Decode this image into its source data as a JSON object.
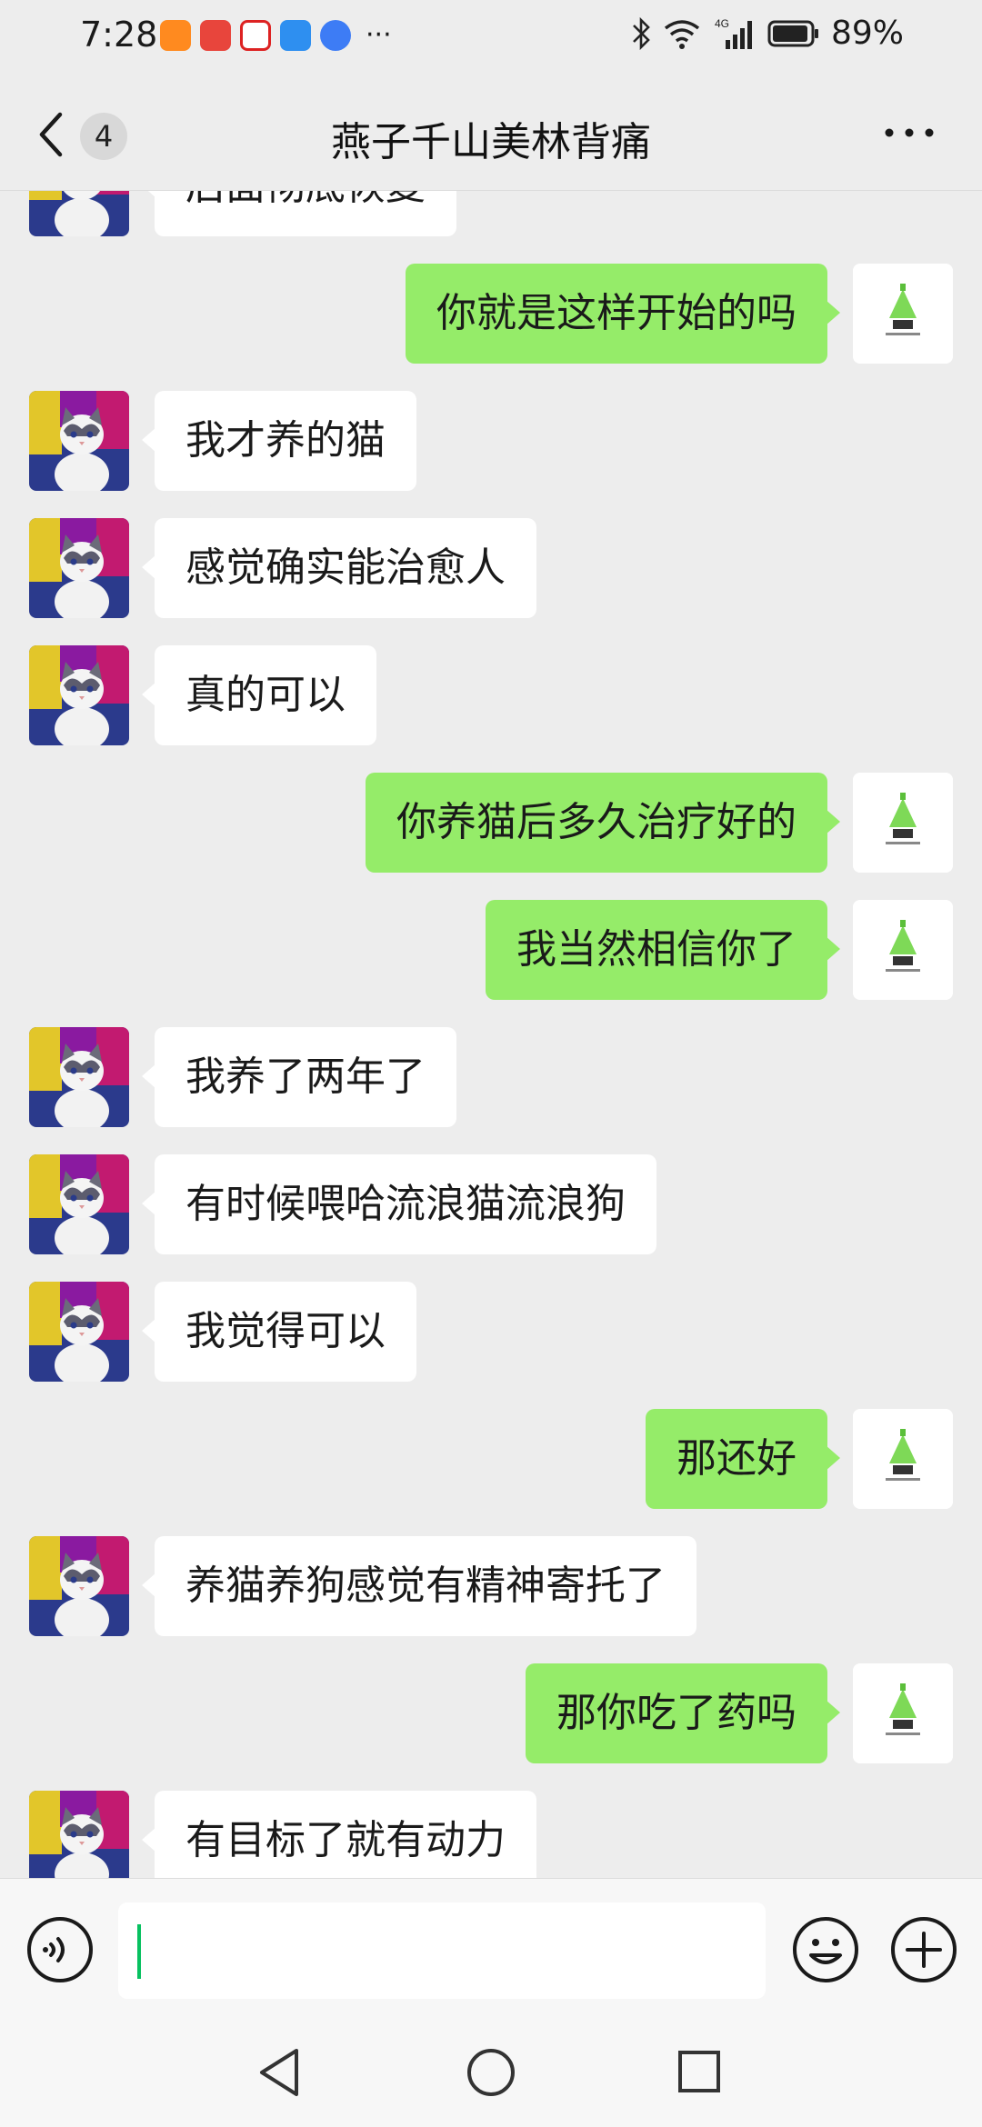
{
  "status_bar": {
    "time": "7:28",
    "network": "4G",
    "battery": "89%"
  },
  "header": {
    "unread_count": "4",
    "title": "燕子千山美林背痛"
  },
  "messages": [
    {
      "side": "left",
      "text": "后面彻底恢复"
    },
    {
      "side": "right",
      "text": "你就是这样开始的吗"
    },
    {
      "side": "left",
      "text": "我才养的猫"
    },
    {
      "side": "left",
      "text": "感觉确实能治愈人"
    },
    {
      "side": "left",
      "text": "真的可以"
    },
    {
      "side": "right",
      "text": "你养猫后多久治疗好的"
    },
    {
      "side": "right",
      "text": "我当然相信你了"
    },
    {
      "side": "left",
      "text": "我养了两年了"
    },
    {
      "side": "left",
      "text": "有时候喂哈流浪猫流浪狗"
    },
    {
      "side": "left",
      "text": "我觉得可以"
    },
    {
      "side": "right",
      "text": "那还好"
    },
    {
      "side": "left",
      "text": "养猫养狗感觉有精神寄托了"
    },
    {
      "side": "right",
      "text": "那你吃了药吗"
    },
    {
      "side": "left",
      "text": "有目标了就有动力"
    }
  ],
  "input": {
    "value": "",
    "placeholder": ""
  },
  "colors": {
    "sent_bubble": "#95ec69",
    "received_bubble": "#ffffff",
    "background": "#ededed",
    "caret": "#07c160"
  }
}
